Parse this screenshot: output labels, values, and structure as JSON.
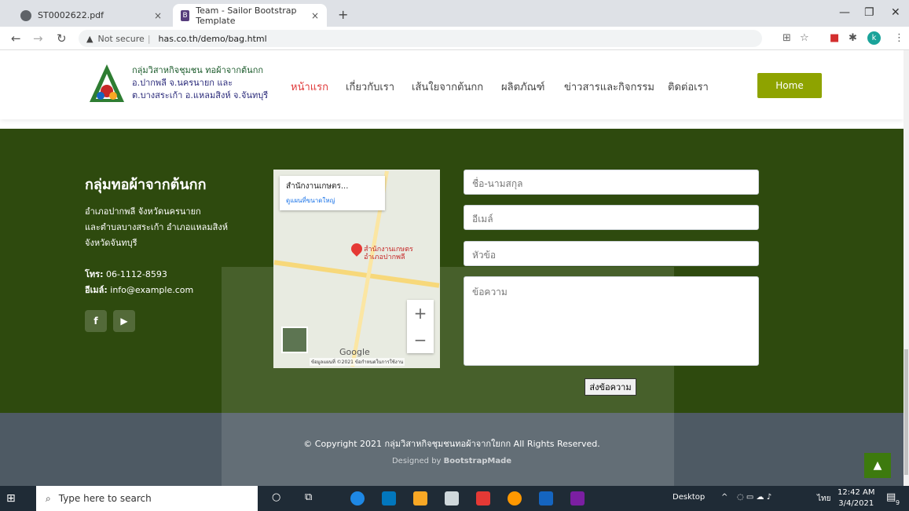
{
  "browser": {
    "tabs": [
      {
        "label": "ST0002622.pdf"
      },
      {
        "label": "Team - Sailor Bootstrap Template"
      }
    ],
    "new_tab": "+",
    "close": "×",
    "address": {
      "security": "Not secure",
      "url": "has.co.th/demo/bag.html"
    }
  },
  "header": {
    "brand_lines": [
      "กลุ่มวิสาหกิจชุมชน ทอผ้าจากต้นกก",
      "อ.ปากพลี จ.นครนายก และ",
      "ต.บางสระเก้า อ.แหลมสิงห์ จ.จันทบุรี"
    ],
    "menu": [
      "หน้าแรก",
      "เกี่ยวกับเรา",
      "เส้นใยจากต้นกก",
      "ผลิตภัณฑ์",
      "ข่าวสารและกิจกรรม",
      "ติดต่อเรา"
    ],
    "home_button": "Home"
  },
  "footer": {
    "title": "กลุ่มทอผ้าจากต้นกก",
    "address_lines": [
      "อำเภอปากพลี จังหวัดนครนายก",
      "และตำบลบางสระเก้า อำเภอแหลมสิงห์",
      "จังหวัดจันทบุรี"
    ],
    "phone_label": "โทร:",
    "phone": "06-1112-8593",
    "email_label": "อีเมล์:",
    "email": "info@example.com",
    "social": [
      "f",
      "▶"
    ]
  },
  "map": {
    "place": "สำนักงานเกษตร...",
    "link": "ดูแผนที่ขนาดใหญ่",
    "pin_label_1": "สำนักงานเกษตร",
    "pin_label_2": "อำเภอปากพลี",
    "brand": "Google",
    "attribution": "ข้อมูลแผนที่ ©2021   ข้อกำหนดในการใช้งาน",
    "zoom_in": "+",
    "zoom_out": "−"
  },
  "form": {
    "name_placeholder": "ชื่อ-นามสกุล",
    "email_placeholder": "อีเมล์",
    "subject_placeholder": "หัวข้อ",
    "message_placeholder": "ข้อความ",
    "submit": "ส่งข้อความ"
  },
  "bottom": {
    "copyright": "© Copyright 2021 กลุ่มวิสาหกิจชุมชนทอผ้าจากใยกก All Rights Reserved.",
    "designed_prefix": "Designed by",
    "designed_by": "BootstrapMade",
    "back_to_top": "▲"
  },
  "taskbar": {
    "search_placeholder": "Type here to search",
    "desktop": "Desktop",
    "lang": "ไทย",
    "time": "12:42 AM",
    "date": "3/4/2021",
    "notif_count": "9"
  },
  "colors": {
    "footer_green": "#2e4a0e",
    "accent_olive": "#8ea300",
    "menu_active": "#e03a3a",
    "bottom_gray": "#4e5a64"
  }
}
